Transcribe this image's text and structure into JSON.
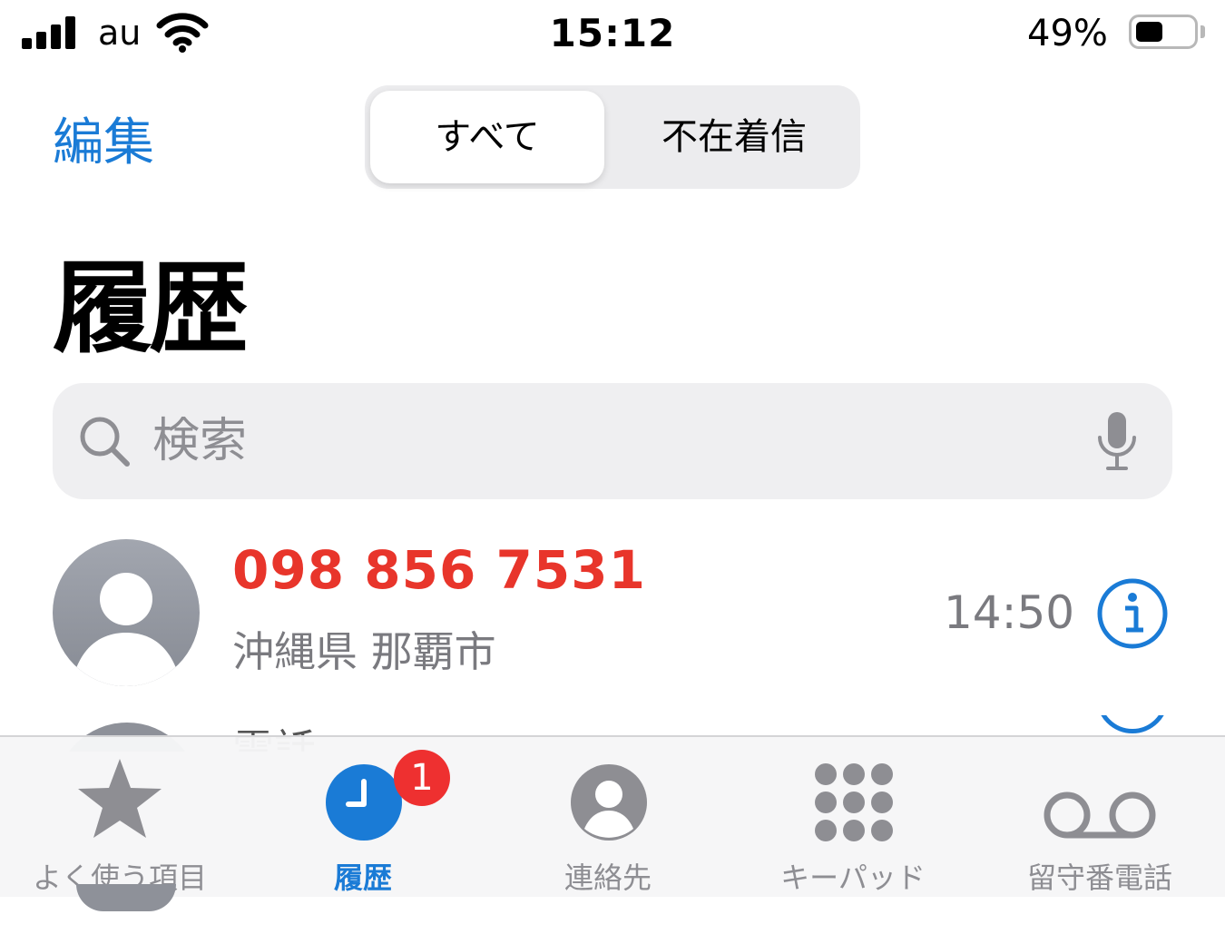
{
  "status_bar": {
    "carrier": "au",
    "time": "15:12",
    "battery_percent": "49%",
    "battery_level": 0.49
  },
  "nav": {
    "edit_label": "編集",
    "segments": [
      "すべて",
      "不在着信"
    ],
    "selected_segment": "すべて"
  },
  "page": {
    "title": "履歴"
  },
  "search": {
    "placeholder": "検索"
  },
  "calls": [
    {
      "number": "098 856 7531",
      "location": "沖縄県 那覇市",
      "time": "14:50",
      "missed": true
    },
    {
      "label_partial": "電話"
    }
  ],
  "tab_bar": {
    "tabs": [
      {
        "label": "よく使う項目",
        "icon": "star-icon"
      },
      {
        "label": "履歴",
        "icon": "clock-icon",
        "badge": "1",
        "active": true
      },
      {
        "label": "連絡先",
        "icon": "person-icon"
      },
      {
        "label": "キーパッド",
        "icon": "keypad-icon"
      },
      {
        "label": "留守番電話",
        "icon": "voicemail-icon"
      }
    ]
  },
  "colors": {
    "accent": "#1a7bd6",
    "missed_call": "#e8352b",
    "badge": "#ee3030",
    "secondary_text": "#7a7a7f"
  }
}
